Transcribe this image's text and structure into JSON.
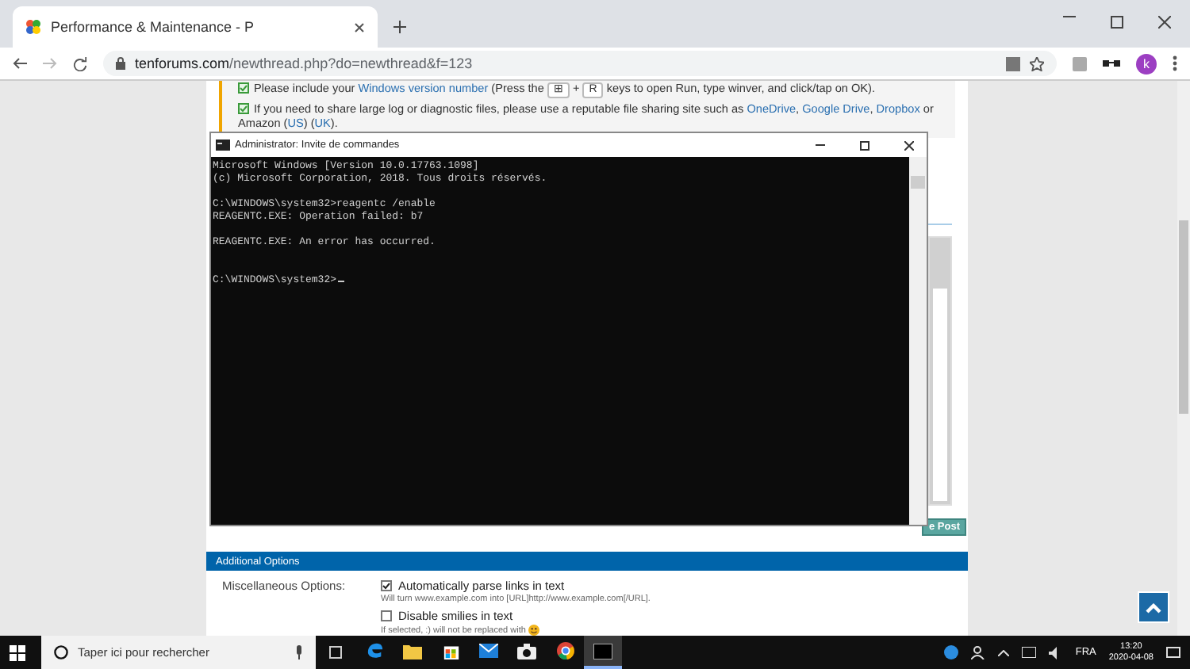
{
  "browser": {
    "tab_title": "Performance & Maintenance - P",
    "url_host": "tenforums.com",
    "url_path": "/newthread.php?do=newthread&f=123",
    "profile_initial": "k"
  },
  "notice": {
    "items": [
      {
        "checked": true,
        "segments": [
          {
            "kind": "text",
            "text": "Please include your "
          },
          {
            "kind": "link",
            "text": "Windows version number"
          },
          {
            "kind": "text",
            "text": " (Press the "
          },
          {
            "kind": "key",
            "text": "⊞"
          },
          {
            "kind": "text",
            "text": " + "
          },
          {
            "kind": "key",
            "text": "R"
          },
          {
            "kind": "text",
            "text": " keys to open Run, type winver, and click/tap on OK)."
          }
        ]
      },
      {
        "checked": true,
        "segments": [
          {
            "kind": "text",
            "text": "If you need to share large log or diagnostic files, please use a reputable file sharing site such as "
          },
          {
            "kind": "link",
            "text": "OneDrive"
          },
          {
            "kind": "text",
            "text": ", "
          },
          {
            "kind": "link",
            "text": "Google Drive"
          },
          {
            "kind": "text",
            "text": ", "
          },
          {
            "kind": "link",
            "text": "Dropbox"
          },
          {
            "kind": "text",
            "text": " or Amazon ("
          },
          {
            "kind": "link",
            "text": "US"
          },
          {
            "kind": "text",
            "text": ") ("
          },
          {
            "kind": "link",
            "text": "UK"
          },
          {
            "kind": "text",
            "text": ")."
          }
        ]
      }
    ]
  },
  "console": {
    "title": "Administrator: Invite de commandes",
    "blocks": [
      [
        "Microsoft Windows [Version 10.0.17763.1098]",
        "(c) Microsoft Corporation, 2018. Tous droits réservés."
      ],
      [
        "C:\\WINDOWS\\system32>reagentc /enable",
        "REAGENTC.EXE: Operation failed: b7"
      ],
      [
        "REAGENTC.EXE: An error has occurred."
      ],
      [
        "C:\\WINDOWS\\system32>"
      ]
    ]
  },
  "editor": {
    "submit_label": "e Post"
  },
  "additional_options": {
    "title": "Additional Options",
    "row_label": "Miscellaneous Options:",
    "options": [
      {
        "label": "Automatically parse links in text",
        "checked": true,
        "hint": "Will turn www.example.com into [URL]http://www.example.com[/URL]."
      },
      {
        "label": "Disable smilies in text",
        "checked": false,
        "hint": "If selected, :) will not be replaced with"
      }
    ]
  },
  "taskbar": {
    "search_placeholder": "Taper ici pour rechercher",
    "apps": [
      {
        "kind": "edge",
        "active": false
      },
      {
        "kind": "folder",
        "active": false
      },
      {
        "kind": "store",
        "active": false
      },
      {
        "kind": "mail",
        "active": false
      },
      {
        "kind": "camera",
        "active": false
      },
      {
        "kind": "chrome",
        "active": false
      },
      {
        "kind": "console",
        "active": true
      }
    ],
    "language": "FRA",
    "time": "13:20",
    "date": "2020-04-08"
  }
}
